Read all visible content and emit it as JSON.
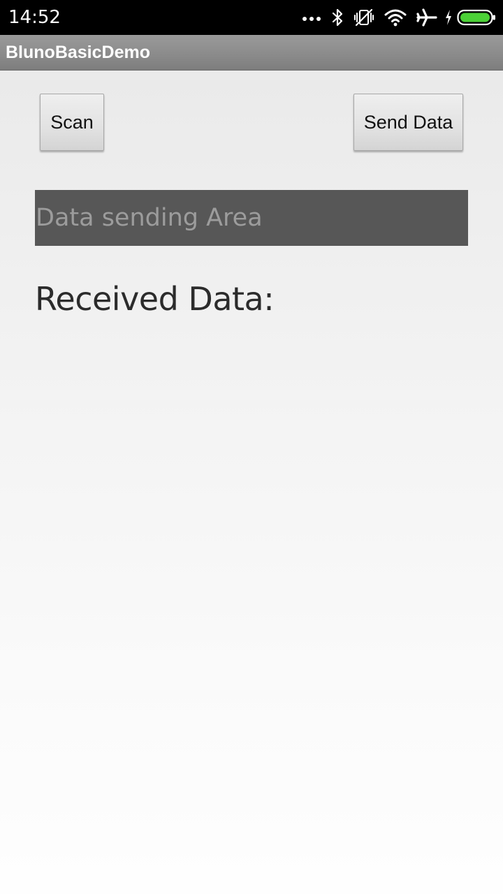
{
  "status_bar": {
    "time": "14:52",
    "icons": [
      "more-dots-icon",
      "bluetooth-icon",
      "vibrate-off-icon",
      "wifi-icon",
      "airplane-mode-icon",
      "charging-icon",
      "battery-icon"
    ]
  },
  "app": {
    "title": "BlunoBasicDemo"
  },
  "buttons": {
    "scan_label": "Scan",
    "send_label": "Send Data"
  },
  "send_area": {
    "value": "",
    "placeholder": "Data sending Area"
  },
  "received": {
    "label": "Received Data:"
  },
  "colors": {
    "status_bar": "#000000",
    "title_bar": "#8a8a8a",
    "input_background": "#575757",
    "battery_fill": "#4cd137"
  }
}
